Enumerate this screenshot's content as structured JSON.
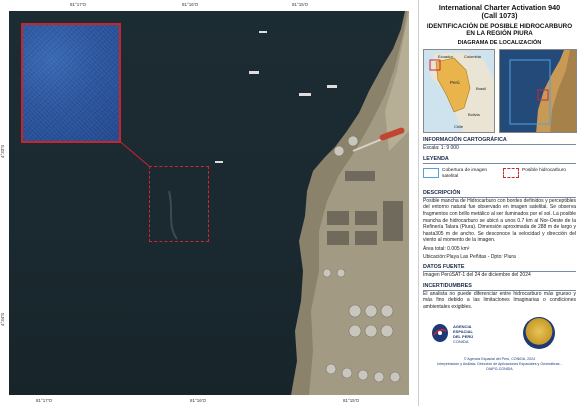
{
  "header": {
    "title": "International Charter Activation 940",
    "call": "(Call 1073)",
    "subtitle": "IDENTIFICACIÓN DE POSIBLE HIDROCARBURO EN LA REGIÓN PIURA",
    "diagram": "DIAGRAMA DE LOCALIZACIÓN"
  },
  "location_map": {
    "labels": {
      "ecuador": "Ecuador",
      "colombia": "Colombia",
      "peru": "Perú",
      "brazil": "Brasil",
      "bolivia": "Bolivia",
      "chile": "Chile"
    }
  },
  "map": {
    "ticks_top": [
      "81°17'O",
      "81°16'O",
      "81°15'O"
    ],
    "ticks_bottom": [
      "81°17'O",
      "81°16'O",
      "81°15'O"
    ],
    "ticks_left": [
      "4°33'S",
      "4°34'S"
    ]
  },
  "cartographic": {
    "heading": "INFORMACIÓN CARTOGRÁFICA",
    "scale": "Escala:  1: 9 000"
  },
  "legend": {
    "heading": "LEYENDA",
    "coverage": "Cobertura de imagen satelital",
    "possible": "Posible hidrocarburo"
  },
  "description": {
    "heading": "DESCRIPCIÓN",
    "body": "Posible mancha de Hidrocarburo con bordes definidos y perceptibles del entorno natural fue observado en imagen satelital. Se observa fragmentos con brillo metálico al ser iluminados por el sol. La posible mancha de hidrocarburo se ubicó a unos 0.7 km al Nor-Oeste de la Refinería Talara (Piura). Dimensión aproximada de 288 m de largo y hasta305 m de ancho. Se desconoce la velocidad y dirección del viento al momento de la imagen.",
    "area": "Área total: 0.005 km²",
    "location": "Ubicación:Playa Las Peñitas - Dpto: Piura"
  },
  "sources": {
    "heading": "DATOS FUENTE",
    "body": "Imagen PerúSAT-1 del 24 de diciembre del 2024"
  },
  "uncertainty": {
    "heading": "INCERTIDUMBRES",
    "body": "El analista no puede diferenciar entre hidrocarburo más grueso y más fino debido a las limitaciones Imaginarias o condiciones ambientales exigibles."
  },
  "logos": {
    "agency_line1": "AGENCIA ESPACIAL",
    "agency_line2": "DEL PERÚ",
    "agency_line3": "CONIDA"
  },
  "footer": {
    "line1": "© Agencia Espacial del Perú, CONIDA, 2024",
    "line2": "Interpretación y Análisis: Dirección de Aplicaciones Espaciales y Geomáticas -",
    "line3": "DIAPG-CONIDA"
  }
}
